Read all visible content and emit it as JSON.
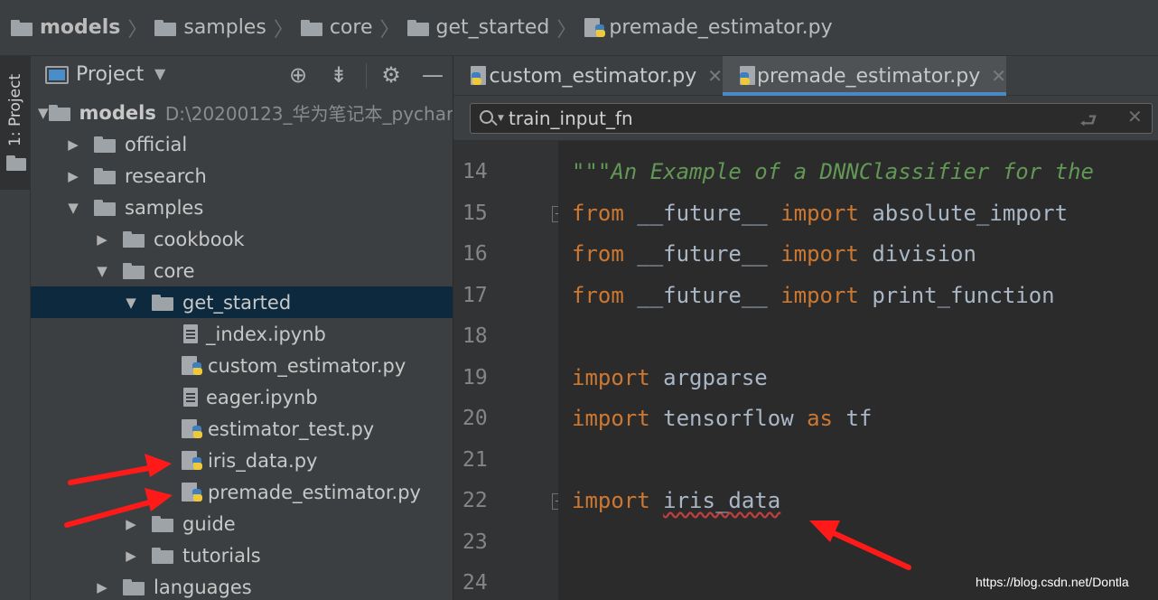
{
  "breadcrumb": {
    "items": [
      {
        "label": "models",
        "icon": "folder-icon"
      },
      {
        "label": "samples",
        "icon": "folder-icon"
      },
      {
        "label": "core",
        "icon": "folder-icon"
      },
      {
        "label": "get_started",
        "icon": "folder-icon"
      },
      {
        "label": "premade_estimator.py",
        "icon": "python-file-icon"
      }
    ],
    "separator": "〉"
  },
  "toolstrip": {
    "project_label": "1: Project"
  },
  "project_panel": {
    "title": "Project",
    "dropdown": "▼",
    "header_icons": [
      "locate-icon",
      "collapse-all-icon",
      "gear-icon",
      "minimize-icon"
    ],
    "tree": [
      {
        "label": "models",
        "path": "D:\\20200123_华为笔记本_pychar",
        "arrow": "▼",
        "icon": "folder",
        "bold": true
      },
      {
        "label": "official",
        "arrow": "▶",
        "icon": "folder"
      },
      {
        "label": "research",
        "arrow": "▶",
        "icon": "folder"
      },
      {
        "label": "samples",
        "arrow": "▼",
        "icon": "folder"
      },
      {
        "label": "cookbook",
        "arrow": "▶",
        "icon": "folder"
      },
      {
        "label": "core",
        "arrow": "▼",
        "icon": "folder"
      },
      {
        "label": "get_started",
        "arrow": "▼",
        "icon": "folder",
        "selected": true
      },
      {
        "label": "_index.ipynb",
        "icon": "notebook"
      },
      {
        "label": "custom_estimator.py",
        "icon": "python"
      },
      {
        "label": "eager.ipynb",
        "icon": "notebook"
      },
      {
        "label": "estimator_test.py",
        "icon": "python"
      },
      {
        "label": "iris_data.py",
        "icon": "python"
      },
      {
        "label": "premade_estimator.py",
        "icon": "python"
      },
      {
        "label": "guide",
        "arrow": "▶",
        "icon": "folder"
      },
      {
        "label": "tutorials",
        "arrow": "▶",
        "icon": "folder"
      },
      {
        "label": "languages",
        "arrow": "▶",
        "icon": "folder"
      }
    ]
  },
  "editor": {
    "tabs": [
      {
        "label": "custom_estimator.py",
        "close": "✕",
        "active": false
      },
      {
        "label": "premade_estimator.py",
        "close": "✕",
        "active": true
      }
    ],
    "search": {
      "value": "train_input_fn",
      "enter_glyph": "⮐",
      "clear_glyph": "✕"
    },
    "line_numbers": [
      "14",
      "15",
      "16",
      "17",
      "18",
      "19",
      "20",
      "21",
      "22",
      "23",
      "24"
    ],
    "lines": [
      {
        "docstring": "\"\"\"An Example of a DNNClassifier for the"
      },
      {
        "kw1": "from",
        "t1": " __future__ ",
        "kw2": "import",
        "t2": " absolute_import"
      },
      {
        "kw1": "from",
        "t1": " __future__ ",
        "kw2": "import",
        "t2": " division"
      },
      {
        "kw1": "from",
        "t1": " __future__ ",
        "kw2": "import",
        "t2": " print_function"
      },
      {},
      {
        "kw1": "import",
        "t1": " argparse"
      },
      {
        "kw1": "import",
        "t1": " tensorflow ",
        "kw2": "as",
        "t2": " tf"
      },
      {},
      {
        "kw1": "import",
        "t1": " ",
        "err": "iris_data"
      },
      {},
      {}
    ]
  },
  "annotations": {
    "arrow_color": "#ff1a1a",
    "watermark": "https://blog.csdn.net/Dontla"
  },
  "colors": {
    "keyword": "#cc7832",
    "docstring": "#629755",
    "text": "#a9b7c6",
    "selection": "#0d293e",
    "tab_underline": "#4a88c7"
  }
}
